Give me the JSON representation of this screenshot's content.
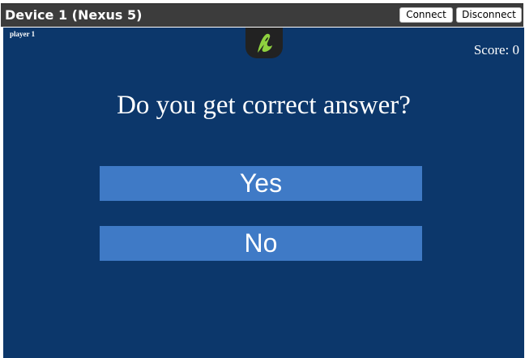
{
  "window": {
    "title": "Device 1 (Nexus 5)",
    "connect_label": "Connect",
    "disconnect_label": "Disconnect"
  },
  "screen": {
    "player_label": "player 1",
    "logo_icon": "airconsole-logo-icon",
    "score_text": "Score: 0",
    "question": "Do you get correct answer?",
    "answers": [
      {
        "label": "Yes"
      },
      {
        "label": "No"
      }
    ]
  },
  "colors": {
    "titlebar": "#3c3c3c",
    "screen_background": "#0c376b",
    "answer_button": "#3f7ac6",
    "logo_accent": "#8fd13f"
  }
}
